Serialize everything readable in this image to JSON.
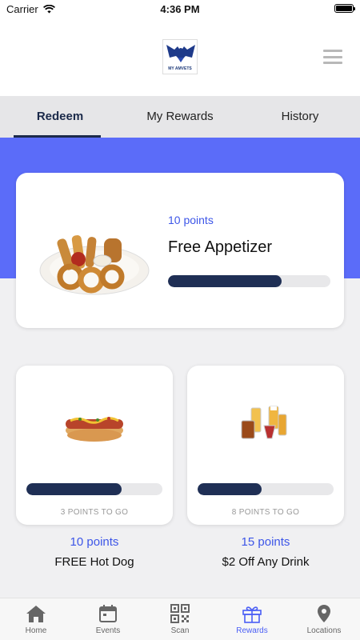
{
  "status_bar": {
    "carrier": "Carrier",
    "time": "4:36 PM"
  },
  "header": {
    "logo_text": "MY AMVETS",
    "menu_icon": "hamburger-menu-icon"
  },
  "tabs": [
    {
      "label": "Redeem",
      "active": true
    },
    {
      "label": "My Rewards",
      "active": false
    },
    {
      "label": "History",
      "active": false
    }
  ],
  "featured": {
    "points": "10 points",
    "title": "Free Appetizer",
    "progress": 0.7
  },
  "rewards": [
    {
      "to_go": "3 POINTS TO GO",
      "points": "10 points",
      "title": "FREE Hot Dog",
      "progress": 0.7
    },
    {
      "to_go": "8 POINTS TO GO",
      "points": "15 points",
      "title": "$2 Off Any Drink",
      "progress": 0.47
    }
  ],
  "nav": [
    {
      "label": "Home",
      "icon": "home-icon"
    },
    {
      "label": "Events",
      "icon": "calendar-icon"
    },
    {
      "label": "Scan",
      "icon": "qr-code-icon"
    },
    {
      "label": "Rewards",
      "icon": "gift-icon",
      "active": true
    },
    {
      "label": "Locations",
      "icon": "location-pin-icon"
    }
  ],
  "colors": {
    "accent": "#5b6cf9",
    "points_text": "#3d56e8",
    "progress_fill": "#1f2f55",
    "nav_active": "#4a5ef5"
  }
}
